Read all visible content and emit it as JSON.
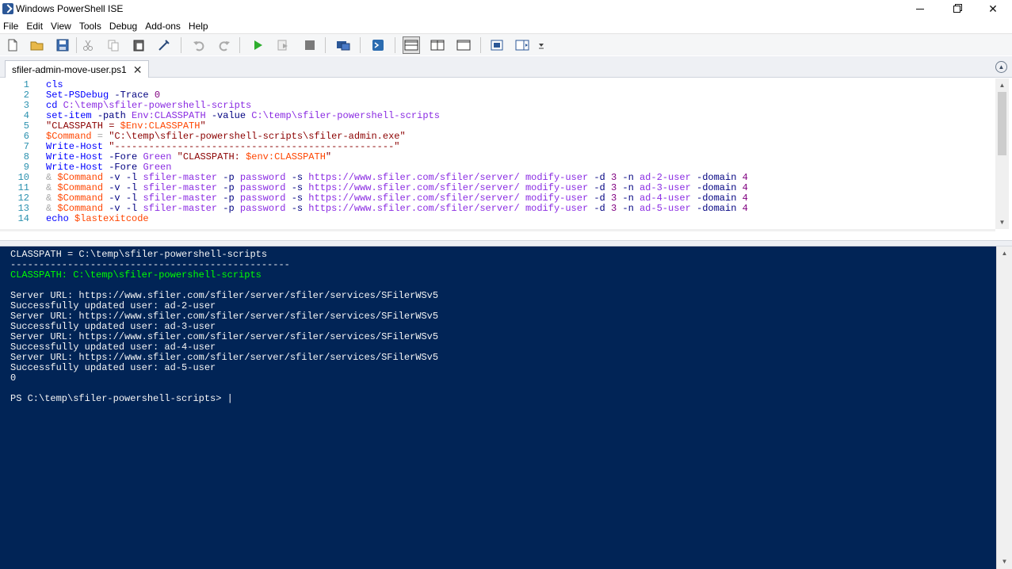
{
  "window": {
    "title": "Windows PowerShell ISE",
    "minimize_icon": "minimize-icon",
    "maximize_icon": "restore-icon",
    "close_glyph": "✕"
  },
  "menu": [
    "File",
    "Edit",
    "View",
    "Tools",
    "Debug",
    "Add-ons",
    "Help"
  ],
  "toolbar": {
    "buttons": [
      {
        "name": "new-icon"
      },
      {
        "name": "open-icon"
      },
      {
        "name": "save-icon"
      },
      {
        "name": "cut-icon"
      },
      {
        "name": "copy-icon"
      },
      {
        "name": "paste-icon"
      },
      {
        "name": "clear-console-icon"
      },
      {
        "name": "undo-icon"
      },
      {
        "name": "redo-icon"
      },
      {
        "name": "run-script-icon"
      },
      {
        "name": "run-selection-icon"
      },
      {
        "name": "stop-icon"
      },
      {
        "name": "remote-powershell-icon"
      },
      {
        "name": "start-powershell-icon"
      },
      {
        "name": "layout-top-icon"
      },
      {
        "name": "layout-right-icon"
      },
      {
        "name": "layout-max-icon"
      },
      {
        "name": "show-script-pane-icon"
      },
      {
        "name": "show-command-addon-icon"
      }
    ],
    "accent_run": "#2eae2e"
  },
  "tab": {
    "label": "sfiler-admin-move-user.ps1",
    "close_glyph": "✕"
  },
  "editor": {
    "lines": [
      {
        "n": "1",
        "tokens": [
          [
            "kw",
            "cls"
          ]
        ]
      },
      {
        "n": "2",
        "tokens": [
          [
            "cmd",
            "Set-PSDebug "
          ],
          [
            "par",
            "-Trace "
          ],
          [
            "num",
            "0"
          ]
        ]
      },
      {
        "n": "3",
        "tokens": [
          [
            "cmd",
            "cd "
          ],
          [
            "arg",
            "C:\\temp\\sfiler-powershell-scripts"
          ]
        ]
      },
      {
        "n": "4",
        "tokens": [
          [
            "cmd",
            "set-item "
          ],
          [
            "par",
            "-path "
          ],
          [
            "arg",
            "Env:CLASSPATH "
          ],
          [
            "par",
            "-value "
          ],
          [
            "arg",
            "C:\\temp\\sfiler-powershell-scripts"
          ]
        ]
      },
      {
        "n": "5",
        "tokens": [
          [
            "str",
            "\"CLASSPATH = "
          ],
          [
            "var",
            "$Env:CLASSPATH"
          ],
          [
            "str",
            "\""
          ]
        ]
      },
      {
        "n": "6",
        "tokens": [
          [
            "var",
            "$Command"
          ],
          [
            "op",
            " = "
          ],
          [
            "str",
            "\"C:\\temp\\sfiler-powershell-scripts\\sfiler-admin.exe\""
          ]
        ]
      },
      {
        "n": "7",
        "tokens": [
          [
            "cmd",
            "Write-Host "
          ],
          [
            "str",
            "\"-------------------------------------------------\""
          ]
        ]
      },
      {
        "n": "8",
        "tokens": [
          [
            "cmd",
            "Write-Host "
          ],
          [
            "par",
            "-Fore "
          ],
          [
            "arg",
            "Green "
          ],
          [
            "str",
            "\"CLASSPATH: "
          ],
          [
            "var",
            "$env:CLASSPATH"
          ],
          [
            "str",
            "\""
          ]
        ]
      },
      {
        "n": "9",
        "tokens": [
          [
            "cmd",
            "Write-Host "
          ],
          [
            "par",
            "-Fore "
          ],
          [
            "arg",
            "Green"
          ]
        ]
      },
      {
        "n": "10",
        "tokens": [
          [
            "op",
            "& "
          ],
          [
            "var",
            "$Command "
          ],
          [
            "par",
            "-v -l "
          ],
          [
            "arg",
            "sfiler-master "
          ],
          [
            "par",
            "-p "
          ],
          [
            "arg",
            "password "
          ],
          [
            "par",
            "-s "
          ],
          [
            "arg",
            "https://www.sfiler.com/sfiler/server/ modify-user "
          ],
          [
            "par",
            "-d "
          ],
          [
            "num",
            "3 "
          ],
          [
            "par",
            "-n "
          ],
          [
            "arg",
            "ad-2-user "
          ],
          [
            "par",
            "-domain "
          ],
          [
            "num",
            "4"
          ]
        ]
      },
      {
        "n": "11",
        "tokens": [
          [
            "op",
            "& "
          ],
          [
            "var",
            "$Command "
          ],
          [
            "par",
            "-v -l "
          ],
          [
            "arg",
            "sfiler-master "
          ],
          [
            "par",
            "-p "
          ],
          [
            "arg",
            "password "
          ],
          [
            "par",
            "-s "
          ],
          [
            "arg",
            "https://www.sfiler.com/sfiler/server/ modify-user "
          ],
          [
            "par",
            "-d "
          ],
          [
            "num",
            "3 "
          ],
          [
            "par",
            "-n "
          ],
          [
            "arg",
            "ad-3-user "
          ],
          [
            "par",
            "-domain "
          ],
          [
            "num",
            "4"
          ]
        ]
      },
      {
        "n": "12",
        "tokens": [
          [
            "op",
            "& "
          ],
          [
            "var",
            "$Command "
          ],
          [
            "par",
            "-v -l "
          ],
          [
            "arg",
            "sfiler-master "
          ],
          [
            "par",
            "-p "
          ],
          [
            "arg",
            "password "
          ],
          [
            "par",
            "-s "
          ],
          [
            "arg",
            "https://www.sfiler.com/sfiler/server/ modify-user "
          ],
          [
            "par",
            "-d "
          ],
          [
            "num",
            "3 "
          ],
          [
            "par",
            "-n "
          ],
          [
            "arg",
            "ad-4-user "
          ],
          [
            "par",
            "-domain "
          ],
          [
            "num",
            "4"
          ]
        ]
      },
      {
        "n": "13",
        "tokens": [
          [
            "op",
            "& "
          ],
          [
            "var",
            "$Command "
          ],
          [
            "par",
            "-v -l "
          ],
          [
            "arg",
            "sfiler-master "
          ],
          [
            "par",
            "-p "
          ],
          [
            "arg",
            "password "
          ],
          [
            "par",
            "-s "
          ],
          [
            "arg",
            "https://www.sfiler.com/sfiler/server/ modify-user "
          ],
          [
            "par",
            "-d "
          ],
          [
            "num",
            "3 "
          ],
          [
            "par",
            "-n "
          ],
          [
            "arg",
            "ad-5-user "
          ],
          [
            "par",
            "-domain "
          ],
          [
            "num",
            "4"
          ]
        ]
      },
      {
        "n": "14",
        "tokens": [
          [
            "cmd",
            "echo "
          ],
          [
            "var",
            "$lastexitcode"
          ]
        ]
      }
    ]
  },
  "console": {
    "background": "#012456",
    "lines": [
      {
        "text": "CLASSPATH = C:\\temp\\sfiler-powershell-scripts",
        "color": "white"
      },
      {
        "text": "-------------------------------------------------",
        "color": "white"
      },
      {
        "text": "CLASSPATH: C:\\temp\\sfiler-powershell-scripts",
        "color": "green"
      },
      {
        "text": "",
        "color": "white"
      },
      {
        "text": "Server URL: https://www.sfiler.com/sfiler/server/sfiler/services/SFilerWSv5",
        "color": "white"
      },
      {
        "text": "Successfully updated user: ad-2-user",
        "color": "white"
      },
      {
        "text": "Server URL: https://www.sfiler.com/sfiler/server/sfiler/services/SFilerWSv5",
        "color": "white"
      },
      {
        "text": "Successfully updated user: ad-3-user",
        "color": "white"
      },
      {
        "text": "Server URL: https://www.sfiler.com/sfiler/server/sfiler/services/SFilerWSv5",
        "color": "white"
      },
      {
        "text": "Successfully updated user: ad-4-user",
        "color": "white"
      },
      {
        "text": "Server URL: https://www.sfiler.com/sfiler/server/sfiler/services/SFilerWSv5",
        "color": "white"
      },
      {
        "text": "Successfully updated user: ad-5-user",
        "color": "white"
      },
      {
        "text": "0",
        "color": "white"
      },
      {
        "text": "",
        "color": "white"
      },
      {
        "text": "PS C:\\temp\\sfiler-powershell-scripts> |",
        "color": "white"
      }
    ]
  }
}
